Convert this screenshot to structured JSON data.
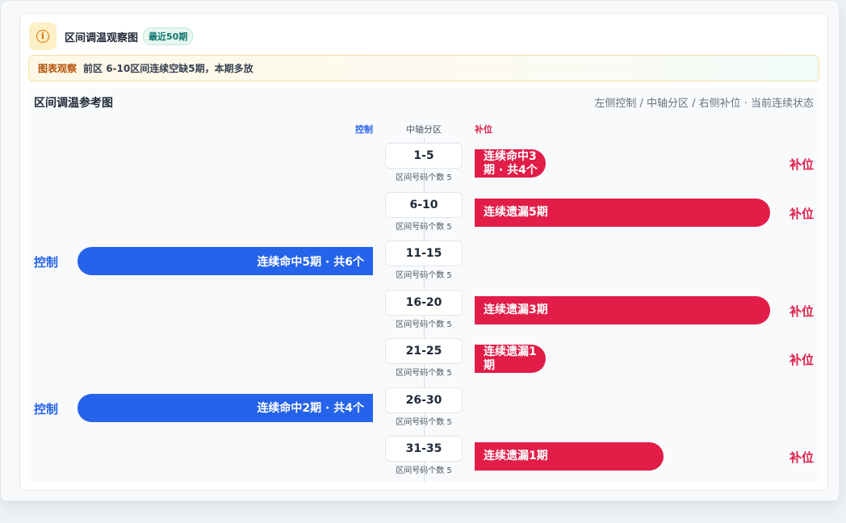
{
  "header": {
    "title": "区间调温观察图",
    "badge": "最近50期"
  },
  "notice": {
    "tag": "图表观察",
    "text": "前区 6-10区间连续空缺5期，本期多放"
  },
  "panel": {
    "title": "区间调温参考图",
    "legend": "左侧控制 / 中轴分区 / 右侧补位 · 当前连续状态",
    "col_left": "控制",
    "col_mid": "中轴分区",
    "col_right": "补位"
  },
  "zones": [
    {
      "range": "1-5",
      "sub": "区间号码个数 5",
      "right_text": "连续命中3期 · 共4个",
      "right_label": "补位",
      "right_level": 0.23
    },
    {
      "range": "6-10",
      "sub": "区间号码个数 5",
      "right_text": "连续遗漏5期",
      "right_label": "补位",
      "right_level": 1.0
    },
    {
      "range": "11-15",
      "sub": "区间号码个数 5",
      "left_text": "连续命中5期 · 共6个",
      "left_label": "控制",
      "left_level": 1.0
    },
    {
      "range": "16-20",
      "sub": "区间号码个数 5",
      "right_text": "连续遗漏3期",
      "right_label": "补位",
      "right_level": 1.0
    },
    {
      "range": "21-25",
      "sub": "区间号码个数 5",
      "right_text": "连续遗漏1期",
      "right_label": "补位",
      "right_level": 0.23
    },
    {
      "range": "26-30",
      "sub": "区间号码个数 5",
      "left_text": "连续命中2期 · 共4个",
      "left_label": "控制",
      "left_level": 1.0
    },
    {
      "range": "31-35",
      "sub": "区间号码个数 5",
      "right_text": "连续遗漏1期",
      "right_label": "补位",
      "right_level": 0.64
    }
  ],
  "colors": {
    "control": "#2563eb",
    "fill": "#e11d48",
    "accent": "#d97706"
  }
}
